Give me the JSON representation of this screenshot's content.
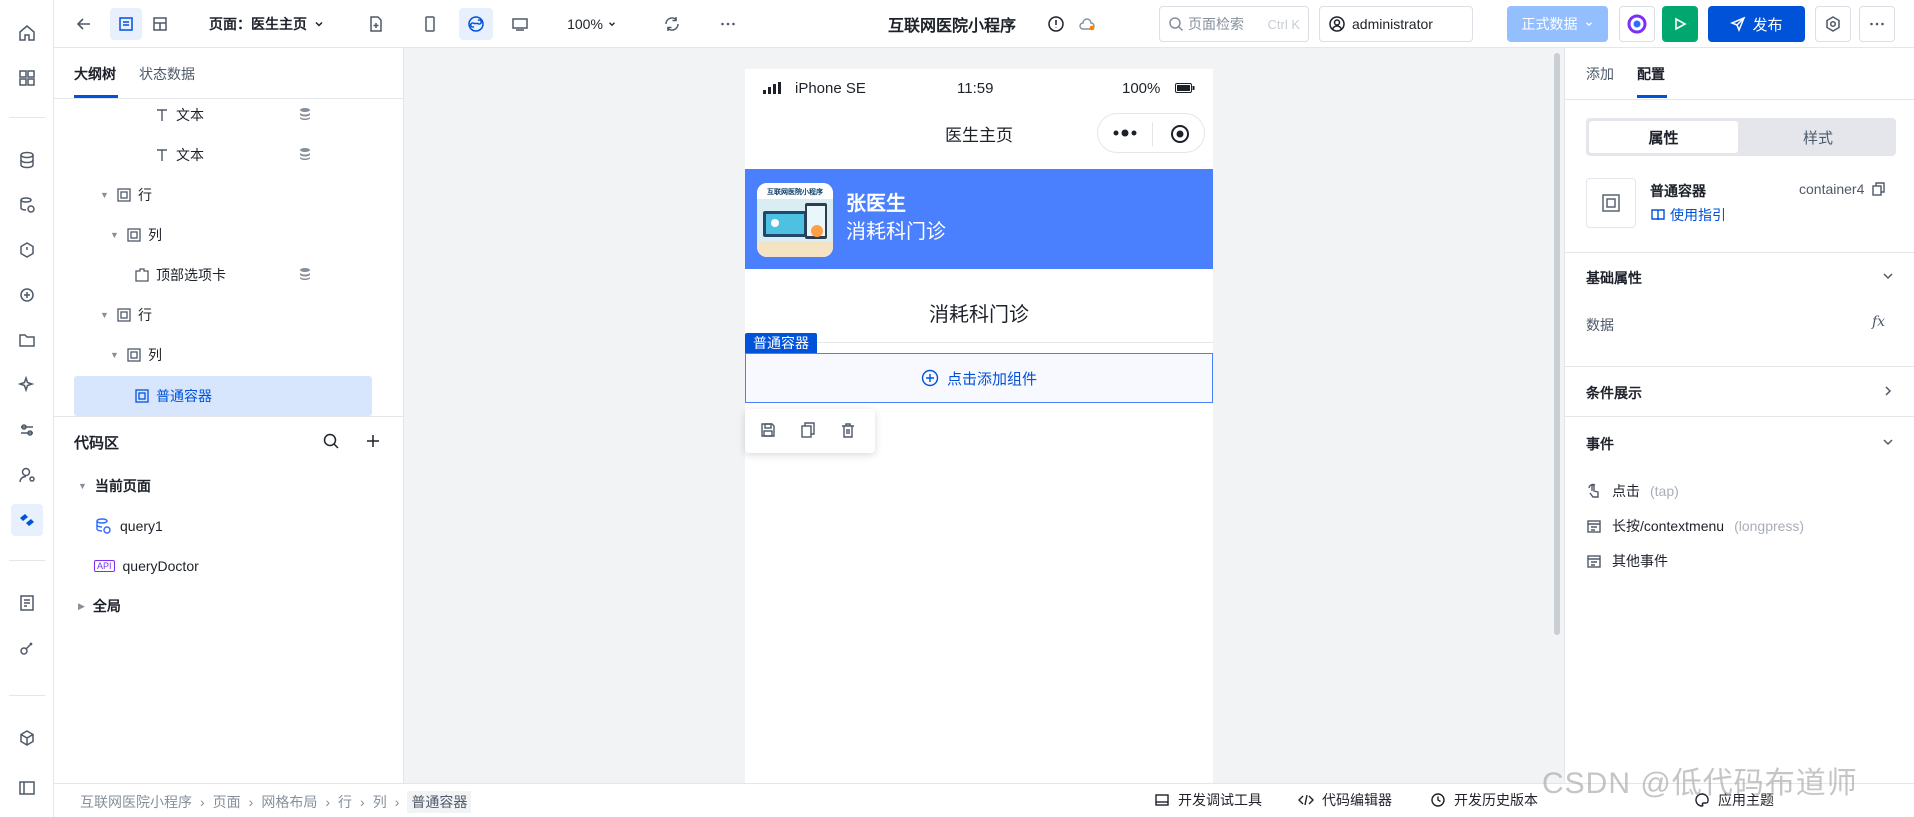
{
  "topbar": {
    "page_label": "页面：医生主页",
    "zoom": "100%",
    "app_title": "互联网医院小程序",
    "search_placeholder": "页面检索",
    "search_shortcut": "Ctrl K",
    "user": "administrator",
    "env": "正式数据",
    "publish": "发布"
  },
  "left_panel": {
    "tabs": [
      "大纲树",
      "状态数据"
    ],
    "tree": [
      {
        "label": "文本",
        "depth": 5
      },
      {
        "label": "文本",
        "depth": 5
      },
      {
        "label": "行",
        "depth": 2
      },
      {
        "label": "列",
        "depth": 3
      },
      {
        "label": "顶部选项卡",
        "depth": 4
      },
      {
        "label": "行",
        "depth": 2
      },
      {
        "label": "列",
        "depth": 3
      },
      {
        "label": "普通容器",
        "depth": 4,
        "selected": true
      }
    ],
    "code_area": {
      "title": "代码区",
      "current_page": "当前页面",
      "items": [
        {
          "label": "query1"
        },
        {
          "label": "queryDoctor",
          "badge": "API"
        }
      ],
      "global": "全局"
    }
  },
  "phone": {
    "device": "iPhone SE",
    "time": "11:59",
    "battery": "100%",
    "nav_title": "医生主页",
    "doctor_name": "张医生",
    "doctor_dept": "消耗科门诊",
    "dept_title": "消耗科门诊",
    "container_tag": "普通容器",
    "add_component": "点击添加组件",
    "avatar_text": "互联网医院小程序"
  },
  "right_panel": {
    "tabs": [
      "添加",
      "配置"
    ],
    "segments": [
      "属性",
      "样式"
    ],
    "component_name": "普通容器",
    "component_id": "container4",
    "guide": "使用指引",
    "sections": {
      "basic": "基础属性",
      "data": "数据",
      "fx": "fx",
      "conditional": "条件展示",
      "events": "事件"
    },
    "events": [
      {
        "label": "点击",
        "hint": "(tap)"
      },
      {
        "label": "长按/contextmenu",
        "hint": "(longpress)"
      },
      {
        "label": "其他事件",
        "hint": ""
      }
    ]
  },
  "bottombar": {
    "breadcrumb": [
      "互联网医院小程序",
      "页面",
      "网格布局",
      "行",
      "列",
      "普通容器"
    ],
    "tools": [
      "开发调试工具",
      "代码编辑器",
      "开发历史版本",
      "应用主题"
    ]
  },
  "watermark": "CSDN @低代码布道师"
}
